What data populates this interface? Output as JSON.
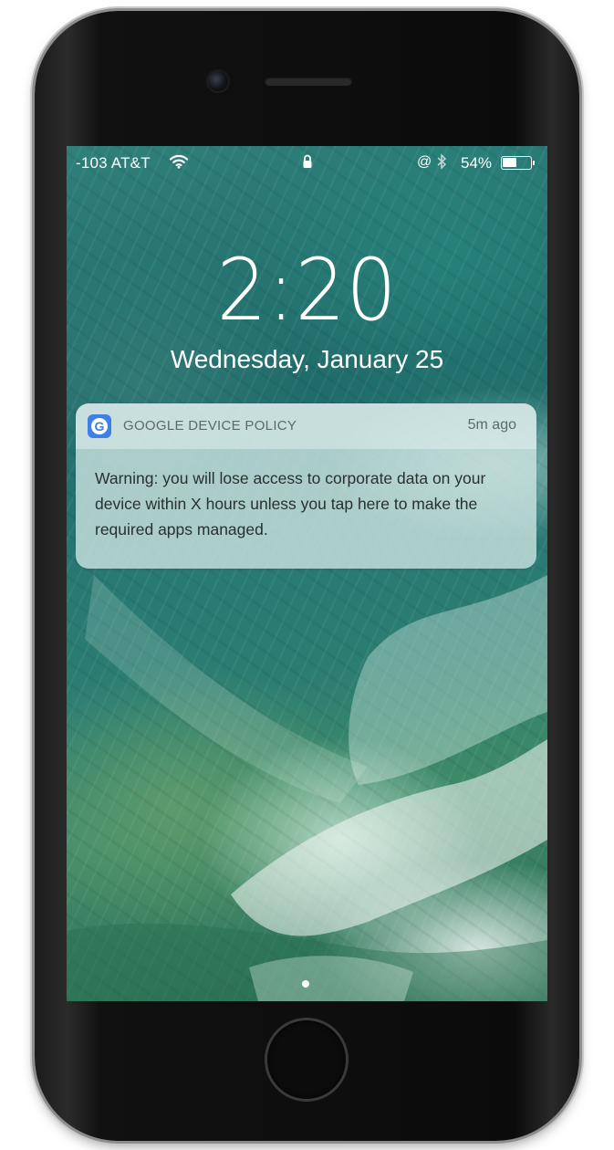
{
  "status_bar": {
    "carrier": "-103 AT&T",
    "battery_percent": "54%",
    "battery_level": 0.54,
    "icons": [
      "wifi-icon",
      "lock-icon",
      "orientation-lock-icon",
      "bluetooth-icon",
      "battery-icon"
    ],
    "at_symbol": "@"
  },
  "lock_screen": {
    "time": "2:20",
    "date": "Wednesday, January 25",
    "page_indicator_count": 1
  },
  "notification": {
    "app_icon_letter": "G",
    "app_icon_color": "#3f7fe8",
    "app_name": "GOOGLE DEVICE POLICY",
    "time_ago": "5m ago",
    "message": "Warning: you will lose access to corporate data on your device within X hours unless you tap here to make the required apps managed."
  },
  "device": {
    "buttons": [
      "mute-switch",
      "volume-up-button",
      "volume-down-button",
      "power-button",
      "home-button"
    ]
  }
}
